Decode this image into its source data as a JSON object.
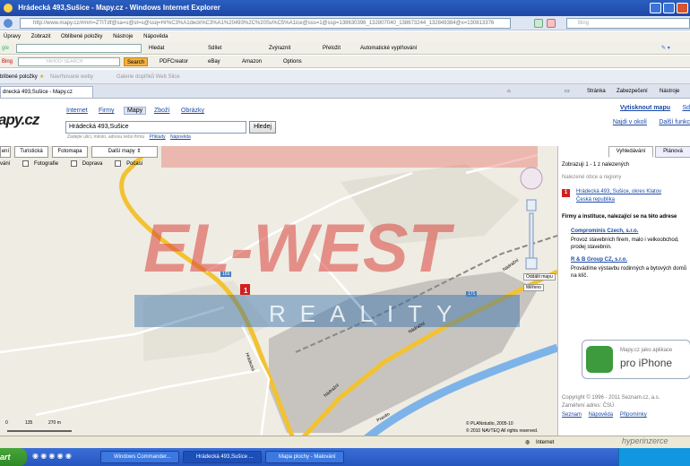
{
  "window": {
    "title": "Hrádecká 493,Sušice - Mapy.cz - Windows Internet Explorer"
  },
  "address_bar": {
    "url": "http://www.mapy.cz/#mm=ZTtTdf@sa=s@st=s@ssq=Hr%C3%A1deck%C3%A1%20493%2C%20Su%C5%A1ice@sss=1@ssp=138630396_132807040_138673244_132849384@x=130813376",
    "search_placeholder": "Bing"
  },
  "menu": [
    "Úpravy",
    "Zobrazit",
    "Oblíbené položky",
    "Nástroje",
    "Nápověda"
  ],
  "toolbar1": {
    "search_engine": "gle",
    "hledat": "Hledat",
    "sdilet": "Sdílet",
    "zvyraznit": "Zvýraznit",
    "prelozit": "Přeložit",
    "autofill": "Automatické vyplňování"
  },
  "toolbar2": {
    "brand": "Bing",
    "yahoo": "YAHOO! SEARCH",
    "search": "Search",
    "pdf": "PDFCreator",
    "ebay": "eBay",
    "amazon": "Amazon",
    "options": "Options"
  },
  "favbar": {
    "label": "blíbené položky",
    "item1": "Navrhované weby",
    "item2": "Galerie doplňků Web Slice"
  },
  "tabs": {
    "active": "dnecká 493,Sušice - Mapy.cz"
  },
  "cmdbar": {
    "stranka": "Stránka",
    "zabezpeceni": "Zabezpečení",
    "nastroje": "Nástroje"
  },
  "site": {
    "logo": "apy.cz",
    "nav": [
      "Internet",
      "Firmy",
      "Mapy",
      "Zboží",
      "Obrázky"
    ],
    "nav_active": "Mapy",
    "search_value": "Hrádecká 493,Sušice",
    "search_button": "Hledej",
    "hint": "Zadejte ulici, město, adresu nebo firmu",
    "hint_links": [
      "Příklady",
      "Nápověda"
    ],
    "print_link": "Vytisknout mapu",
    "print_link2": "Sd",
    "near_link": "Najdi v okolí",
    "more_link": "Další funkc"
  },
  "map": {
    "tabs": [
      "ení",
      "Turistická",
      "Fotomapa",
      "Další mapy"
    ],
    "layers": [
      "vání",
      "Fotografie",
      "Doprava",
      "Počasí"
    ],
    "streets": [
      "Hrádecká",
      "Nádražní",
      "Nádražní",
      "Nádražní",
      "Pravěn"
    ],
    "road_badges": [
      "169",
      "169",
      "171",
      "171"
    ],
    "zoom_labels": [
      "Oddálit mapu",
      "Měřeno"
    ],
    "scale_labels": [
      "0",
      "135",
      "270 m"
    ],
    "copyright": [
      "© PLANstudio, 2005-10",
      "© 2010 NAVTEQ All rights reserved."
    ]
  },
  "panel": {
    "tab1": "Vyhledávání",
    "tab2": "Plánová",
    "results": "Zobrazuji 1 - 1 z nalezených",
    "section1": "Nalezené obce a regiony",
    "result_line1": "Hrádecká 493, Sušice, okres Klatov",
    "result_line2": "Česká republika",
    "section2": "Firmy a instituce, nalezající se na této adrese",
    "firm1": "Comprominis Czech, s.r.o.",
    "firm1_desc": "Provoz stavebních firem, malo i velkoobchod, prodej stavebnin.",
    "firm2": "R & B Group CZ, s.r.o.",
    "firm2_desc": "Provádíme výstavbu rodinných a bytových domů na klíč.",
    "ad_small": "Mapy.cz jako aplikace",
    "ad_big": "pro iPhone",
    "copyright1": "Copyright © 1996 - 2011 Seznam.cz, a.s.",
    "copyright2": "Zaměření adres: ČSÚ",
    "footer_links": [
      "Seznam",
      "Nápověda",
      "Připomínky"
    ]
  },
  "watermark": {
    "brand": "EL-WEST",
    "sub": "REALITY",
    "corner": "hyperinzerce"
  },
  "statusbar": {
    "zone": "Internet"
  },
  "taskbar": {
    "start": "art",
    "items": [
      "Windows Commander...",
      "Hrádecká 493,Sušice ...",
      "Mapa plochy - Malování"
    ]
  }
}
